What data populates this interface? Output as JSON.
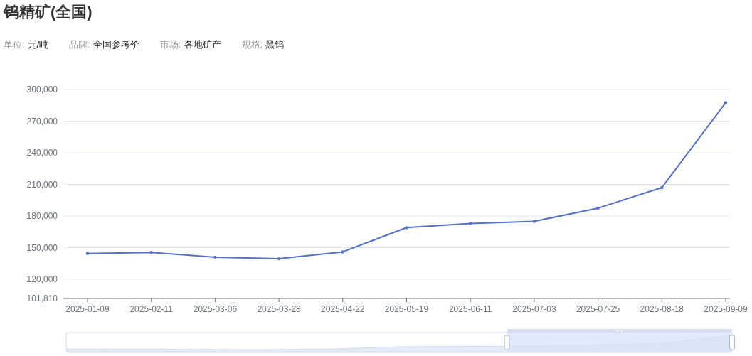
{
  "title": "钨精矿(全国)",
  "meta": [
    {
      "label": "单位:",
      "value": "元/吨"
    },
    {
      "label": "品牌:",
      "value": "全国参考价"
    },
    {
      "label": "市场:",
      "value": "各地矿产"
    },
    {
      "label": "规格:",
      "value": "黑钨"
    }
  ],
  "chart": {
    "chart_data": {
      "type": "line",
      "grid": true,
      "ylim": [
        101810,
        300000
      ],
      "yticks": [
        {
          "value": 101810,
          "label": "101,810"
        },
        {
          "value": 120000,
          "label": "120,000"
        },
        {
          "value": 150000,
          "label": "150,000"
        },
        {
          "value": 180000,
          "label": "180,000"
        },
        {
          "value": 210000,
          "label": "210,000"
        },
        {
          "value": 240000,
          "label": "240,000"
        },
        {
          "value": 270000,
          "label": "270,000"
        },
        {
          "value": 300000,
          "label": "300,000"
        }
      ],
      "categories": [
        "2025-01-09",
        "2025-02-11",
        "2025-03-06",
        "2025-03-28",
        "2025-04-22",
        "2025-05-19",
        "2025-06-11",
        "2025-07-03",
        "2025-07-25",
        "2025-08-18",
        "2025-09-09"
      ],
      "series": [
        {
          "color": "#5470c6",
          "values": [
            144500,
            145500,
            141000,
            139500,
            146000,
            169000,
            173000,
            175000,
            187500,
            207000,
            287500
          ]
        }
      ]
    }
  },
  "data_zoom": {
    "level": 0.338
  }
}
